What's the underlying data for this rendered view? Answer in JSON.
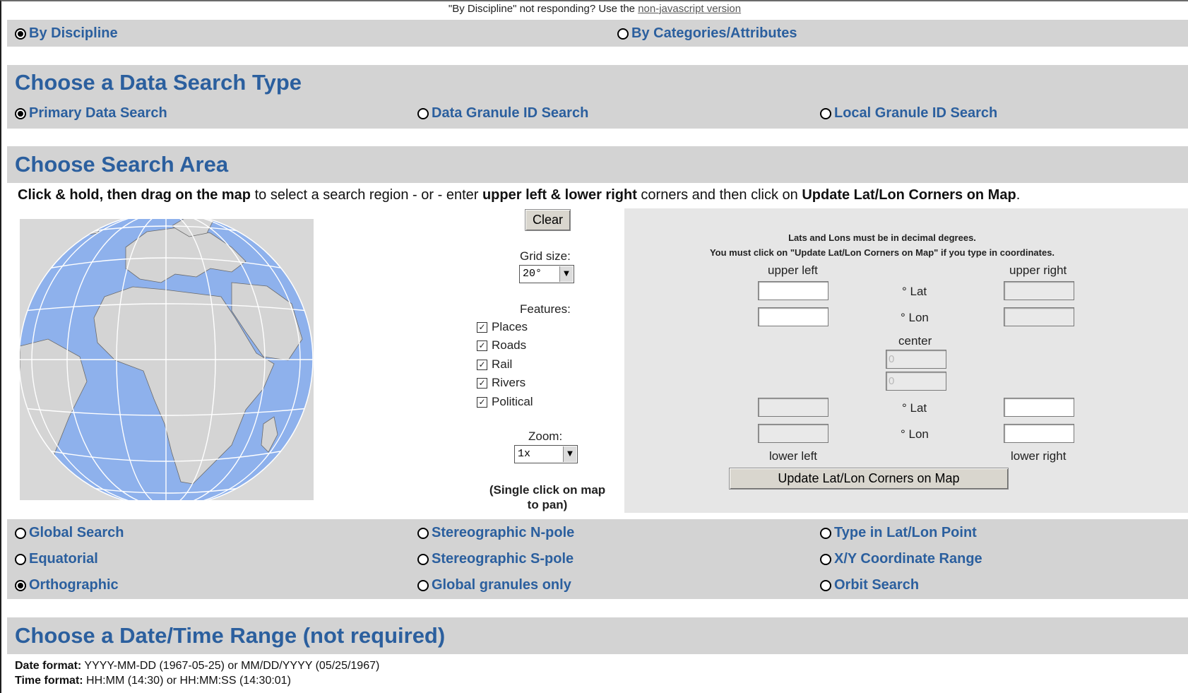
{
  "top_note": {
    "text": "\"By Discipline\" not responding? Use the",
    "link": "non-javascript version"
  },
  "search_mode": {
    "by_discipline": "By Discipline",
    "by_categories": "By Categories/Attributes"
  },
  "data_search_type": {
    "heading": "Choose a Data Search Type",
    "options": [
      "Primary Data Search",
      "Data Granule ID Search",
      "Local Granule ID Search"
    ]
  },
  "search_area": {
    "heading": "Choose Search Area",
    "instruction": {
      "b1": "Click & hold, then drag on the map",
      "t1": " to select a search region - or - enter ",
      "b2": "upper left & lower right",
      "t2": " corners and then click on ",
      "b3": "Update Lat/Lon Corners on Map",
      "t3": "."
    },
    "clear_button": "Clear",
    "grid_size_label": "Grid size:",
    "grid_size_value": "20°",
    "features_label": "Features:",
    "features": [
      "Places",
      "Roads",
      "Rail",
      "Rivers",
      "Political"
    ],
    "zoom_label": "Zoom:",
    "zoom_value": "1x",
    "pan_note": "(Single click on map to pan)",
    "note1": "Lats and Lons must be in decimal degrees.",
    "note2": "You must click on \"Update Lat/Lon Corners on Map\" if you type in coordinates.",
    "upper_left": "upper left",
    "upper_right": "upper right",
    "lower_left": "lower left",
    "lower_right": "lower right",
    "lat": "° Lat",
    "lon": "° Lon",
    "center": "center",
    "center_lat_value": "0",
    "center_lon_value": "0",
    "update_button": "Update Lat/Lon Corners on Map",
    "projections": {
      "col1": [
        "Global Search",
        "Equatorial",
        "Orthographic"
      ],
      "col2": [
        "Stereographic N-pole",
        "Stereographic S-pole",
        "Global granules only"
      ],
      "col3": [
        "Type in Lat/Lon Point",
        "X/Y Coordinate Range",
        "Orbit Search"
      ]
    }
  },
  "date_time": {
    "heading": "Choose a Date/Time Range (not required)",
    "date_label": "Date format:",
    "date_text": " YYYY-MM-DD (1967-05-25) or MM/DD/YYYY (05/25/1967)",
    "time_label": "Time format:",
    "time_text": " HH:MM (14:30) or HH:MM:SS (14:30:01)"
  },
  "colors": {
    "link_blue": "#2b5f9e",
    "band_gray": "#d3d3d3",
    "ocean": "#8eb1ec",
    "land": "#d4d4d4"
  }
}
